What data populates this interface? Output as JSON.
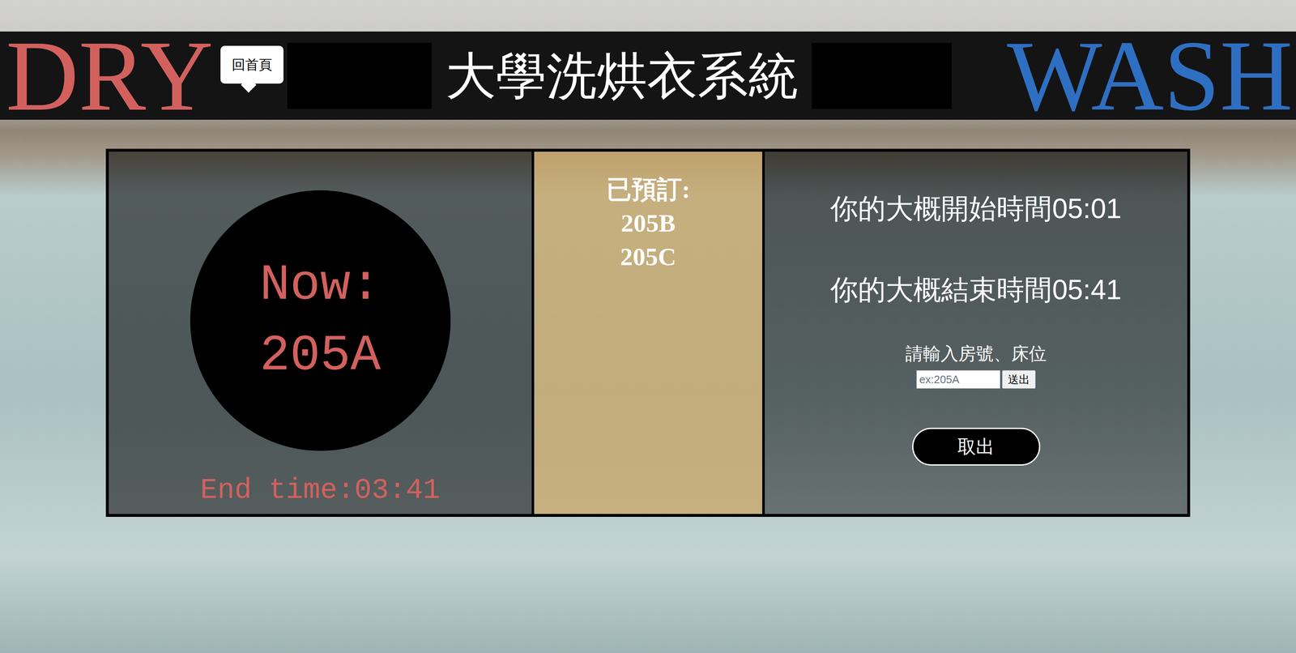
{
  "header": {
    "left_word": "DRY",
    "home_button": "回首頁",
    "title": "大學洗烘衣系統",
    "right_word": "WASH"
  },
  "current": {
    "label": "Now:",
    "room": "205A",
    "end_time": "End time:03:41"
  },
  "reserved": {
    "label": "已預訂:",
    "rooms": [
      "205B",
      "205C"
    ]
  },
  "estimate": {
    "start": "你的大概開始時間05:01",
    "end": "你的大概結束時間05:41"
  },
  "form": {
    "prompt": "請輸入房號、床位",
    "placeholder": "ex:205A",
    "submit": "送出"
  },
  "take_out_button": "取出"
}
